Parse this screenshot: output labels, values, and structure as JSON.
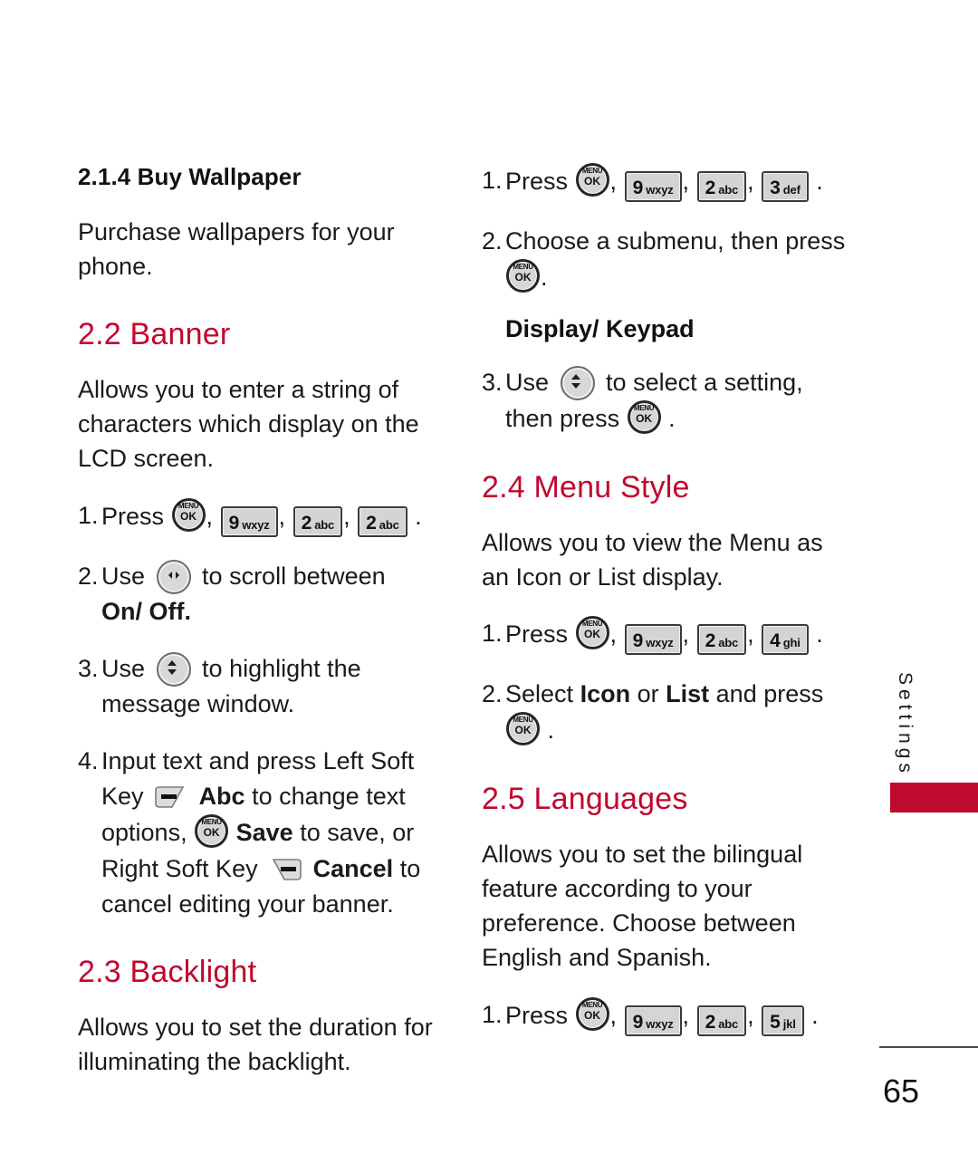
{
  "page": {
    "number": "65",
    "side_tab_label": "Settings",
    "accent_color": "#C1072E",
    "tab_color": "#BE0A2D"
  },
  "left_column": {
    "sub_heading": "2.1.4 Buy Wallpaper",
    "intro_paragraph": "Purchase wallpapers for your phone.",
    "banner": {
      "heading": "2.2 Banner",
      "description": "Allows you to enter a string of characters which display on the LCD screen.",
      "steps": [
        {
          "num": "1.",
          "lead": "Press",
          "keys": [
            "menu-ok-icon",
            "9 wxyz",
            "2 abc",
            "2 abc"
          ],
          "trail": "."
        },
        {
          "num": "2.",
          "lead": "Use",
          "icon": "nav-left-right-icon",
          "text": "to scroll between",
          "bold_tail": "On/ Off."
        },
        {
          "num": "3.",
          "lead": "Use",
          "icon": "nav-up-down-icon",
          "text": "to highlight the message window."
        },
        {
          "num": "4.",
          "parts": [
            "Input text and press Left Soft Key",
            "left-soft-key-icon",
            "Abc",
            "to change text options,",
            "menu-ok-icon",
            "Save",
            "to save, or Right Soft Key",
            "right-soft-key-icon",
            "Cancel",
            "to cancel editing your banner."
          ]
        }
      ]
    },
    "backlight": {
      "heading": "2.3 Backlight",
      "description": "Allows you to set the duration for illuminating the backlight."
    }
  },
  "right_column": {
    "backlight_steps": [
      {
        "num": "1.",
        "lead": "Press",
        "keys": [
          "menu-ok-icon",
          "9 wxyz",
          "2 abc",
          "3 def"
        ],
        "trail": "."
      },
      {
        "num": "2.",
        "text": "Choose a submenu, then press",
        "icon": "menu-ok-icon",
        "trail": "."
      }
    ],
    "display_keypad_heading": "Display/ Keypad",
    "backlight_step_3": {
      "num": "3.",
      "lead": "Use",
      "icon": "nav-up-down-icon",
      "text": "to select a setting, then press",
      "icon2": "menu-ok-icon",
      "trail": "."
    },
    "menu_style": {
      "heading": "2.4 Menu Style",
      "description": "Allows you to view the Menu as an Icon or List display.",
      "steps": [
        {
          "num": "1.",
          "lead": "Press",
          "keys": [
            "menu-ok-icon",
            "9 wxyz",
            "2 abc",
            "4 ghi"
          ],
          "trail": "."
        },
        {
          "num": "2.",
          "pre": "Select",
          "bold1": "Icon",
          "mid": "or",
          "bold2": "List",
          "post": "and press",
          "icon": "menu-ok-icon",
          "trail": "."
        }
      ]
    },
    "languages": {
      "heading": "2.5 Languages",
      "description": "Allows you to set the bilingual feature according to your preference. Choose between English and Spanish.",
      "steps": [
        {
          "num": "1.",
          "lead": "Press",
          "keys": [
            "menu-ok-icon",
            "9 wxyz",
            "2 abc",
            "5 jkl"
          ],
          "trail": "."
        }
      ]
    }
  },
  "keys": {
    "k9": {
      "digit": "9",
      "letters": "wxyz"
    },
    "k2": {
      "digit": "2",
      "letters": "abc"
    },
    "k3": {
      "digit": "3",
      "letters": "def"
    },
    "k4": {
      "digit": "4",
      "letters": "ghi"
    },
    "k5": {
      "digit": "5",
      "letters": "jkl"
    },
    "menu": "MENU",
    "ok": "OK"
  },
  "punctuation": {
    "comma": ",",
    "period": "."
  }
}
